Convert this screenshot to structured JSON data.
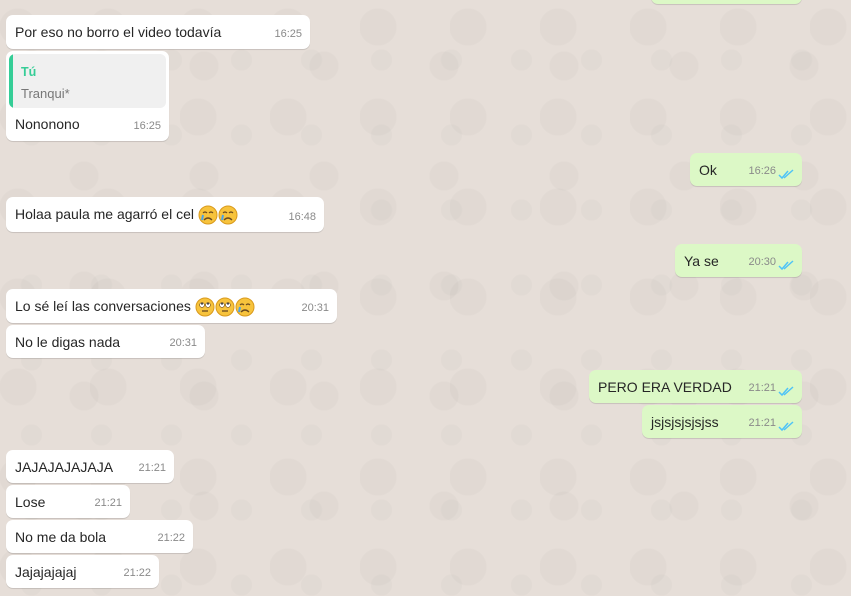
{
  "messages": [
    {
      "text": "Por eso no borro el video todavía",
      "time": "16:25"
    },
    {
      "quote_author": "Tú",
      "quote_text": "Tranqui*",
      "text": "Nononono",
      "time": "16:25"
    },
    {
      "text": "Ok",
      "time": "16:26"
    },
    {
      "text": "Holaa paula me agarró el cel",
      "time": "16:48"
    },
    {
      "text": "Ya se",
      "time": "20:30"
    },
    {
      "text": "Lo sé leí las conversaciones",
      "time": "20:31"
    },
    {
      "text": "No le digas nada",
      "time": "20:31"
    },
    {
      "text": "PERO ERA VERDAD",
      "time": "21:21"
    },
    {
      "text": "jsjsjsjsjsjss",
      "time": "21:21"
    },
    {
      "text": "JAJAJAJAJAJA",
      "time": "21:21"
    },
    {
      "text": "Lose",
      "time": "21:21"
    },
    {
      "text": "No me da bola",
      "time": "21:22"
    },
    {
      "text": "Jajajajajaj",
      "time": "21:22"
    }
  ],
  "colors": {
    "incoming": "#ffffff",
    "outgoing": "#dcf8c6",
    "read_ticks": "#4fc3f7",
    "quote_accent": "#35cd96",
    "background": "#e5ddd5"
  },
  "icons": [
    "crying-emoji",
    "eye-roll-emoji",
    "double-check-icon"
  ]
}
